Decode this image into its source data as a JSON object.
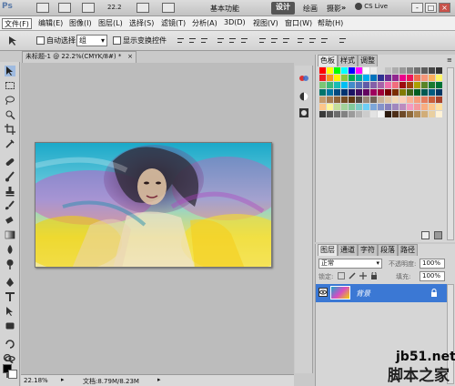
{
  "appbar": {
    "logo": "Ps",
    "zoom": "22.2",
    "ws_basic": "基本功能",
    "ws_design": "设计",
    "ws_painting": "绘画",
    "ws_photo": "摄影",
    "more": "»",
    "cslive": "CS Live",
    "win_min": "-",
    "win_max": "□",
    "win_close": "×"
  },
  "menubar": {
    "items": [
      "文件(F)",
      "编辑(E)",
      "图像(I)",
      "图层(L)",
      "选择(S)",
      "滤镜(T)",
      "分析(A)",
      "3D(D)",
      "视图(V)",
      "窗口(W)",
      "帮助(H)"
    ]
  },
  "options": {
    "auto_select_label": "自动选择:",
    "auto_select_value": "组",
    "show_transform_label": "显示变换控件"
  },
  "document": {
    "tab_title": "未标题-1 @ 22.2%(CMYK/8#) *",
    "tab_close": "×",
    "zoom_status": "22.18%",
    "doc_info": "文档:8.79M/8.23M"
  },
  "swatches": {
    "tabs": [
      "色板",
      "样式",
      "调整"
    ]
  },
  "layers": {
    "tabs": [
      "图层",
      "通道",
      "字符",
      "段落",
      "路径"
    ],
    "blend_mode": "正常",
    "opacity_label": "不透明度:",
    "opacity_value": "100%",
    "lock_label": "锁定:",
    "fill_label": "填充:",
    "fill_value": "100%",
    "layer_name": "背景"
  },
  "watermark": {
    "site": "jb51.net",
    "brand": "脚本之家"
  }
}
